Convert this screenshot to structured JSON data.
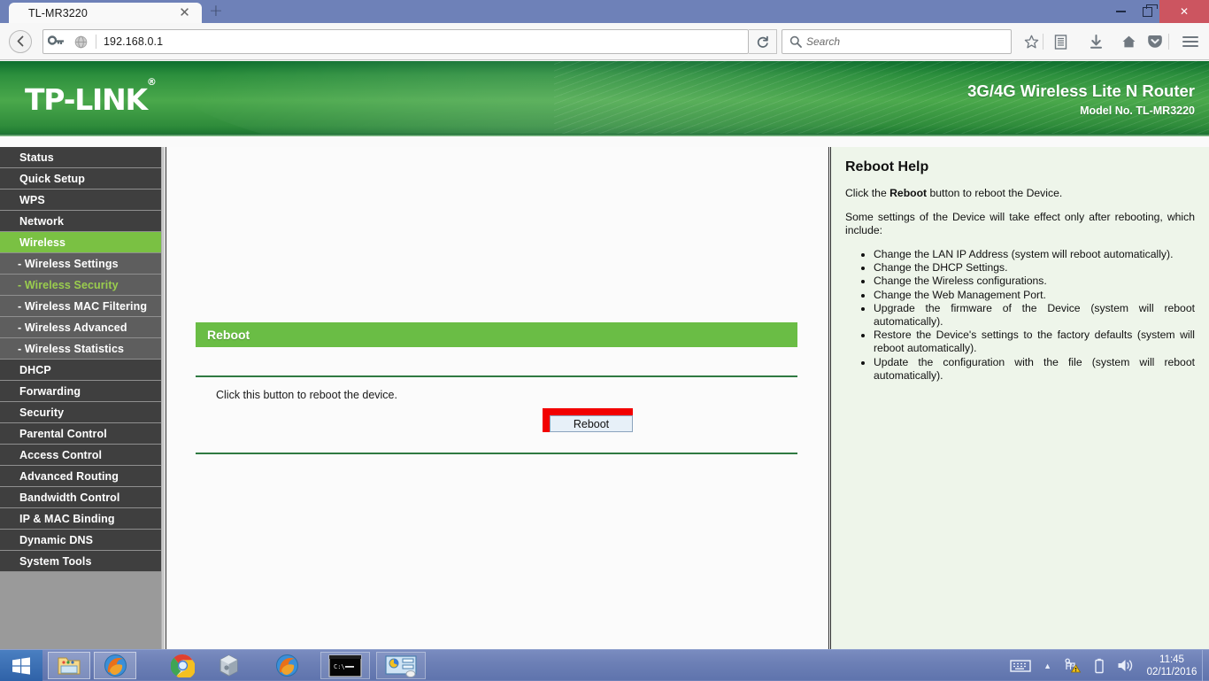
{
  "browser": {
    "tab_title": "TL-MR3220",
    "close_tab_glyph": "✕",
    "new_tab_glyph": "+",
    "back_glyph": "←",
    "reload_glyph": "⟳",
    "url": "192.168.0.1",
    "search_placeholder": "Search",
    "window_controls": {
      "minimize": "—",
      "maximize": "❐",
      "close": "✕"
    },
    "toolbar_icons": [
      "key-icon",
      "globe-icon",
      "star-icon",
      "library-icon",
      "downloads-icon",
      "home-icon",
      "pocket-icon",
      "menu-icon"
    ]
  },
  "router": {
    "brand": "TP-LINK",
    "brand_mark": "®",
    "model_title": "3G/4G Wireless Lite N Router",
    "model_no": "Model No. TL-MR3220",
    "accent_green": "#6abd45",
    "header_green": "#2c8f3d",
    "highlight_red": "#f20000"
  },
  "sidebar": {
    "items": [
      {
        "label": "Status",
        "type": "top",
        "state": "normal"
      },
      {
        "label": "Quick Setup",
        "type": "top",
        "state": "normal"
      },
      {
        "label": "WPS",
        "type": "top",
        "state": "normal"
      },
      {
        "label": "Network",
        "type": "top",
        "state": "normal"
      },
      {
        "label": "Wireless",
        "type": "top",
        "state": "active"
      },
      {
        "label": "- Wireless Settings",
        "type": "sub",
        "state": "normal"
      },
      {
        "label": "- Wireless Security",
        "type": "sub",
        "state": "sub-active"
      },
      {
        "label": "- Wireless MAC Filtering",
        "type": "sub",
        "state": "normal"
      },
      {
        "label": "- Wireless Advanced",
        "type": "sub",
        "state": "normal"
      },
      {
        "label": "- Wireless Statistics",
        "type": "sub",
        "state": "normal"
      },
      {
        "label": "DHCP",
        "type": "top",
        "state": "normal"
      },
      {
        "label": "Forwarding",
        "type": "top",
        "state": "normal"
      },
      {
        "label": "Security",
        "type": "top",
        "state": "normal"
      },
      {
        "label": "Parental Control",
        "type": "top",
        "state": "normal"
      },
      {
        "label": "Access Control",
        "type": "top",
        "state": "normal"
      },
      {
        "label": "Advanced Routing",
        "type": "top",
        "state": "normal"
      },
      {
        "label": "Bandwidth Control",
        "type": "top",
        "state": "normal"
      },
      {
        "label": "IP & MAC Binding",
        "type": "top",
        "state": "normal"
      },
      {
        "label": "Dynamic DNS",
        "type": "top",
        "state": "normal"
      },
      {
        "label": "System Tools",
        "type": "top",
        "state": "normal"
      }
    ]
  },
  "main": {
    "section_title": "Reboot",
    "description": "Click this button to reboot the device.",
    "reboot_button_label": "Reboot"
  },
  "help": {
    "title": "Reboot Help",
    "paragraph_1_pre": "Click the ",
    "paragraph_1_bold": "Reboot",
    "paragraph_1_post": " button to reboot the Device.",
    "paragraph_2": "Some settings of the Device will take effect only after rebooting, which include:",
    "bullets": [
      "Change the LAN IP Address (system will reboot automatically).",
      "Change the DHCP Settings.",
      "Change the Wireless configurations.",
      "Change the Web Management Port.",
      "Upgrade the firmware of the Device (system will reboot automatically).",
      "Restore the Device's settings to the factory defaults (system will reboot automatically).",
      "Update the configuration with the file (system will reboot automatically)."
    ]
  },
  "taskbar": {
    "start_label": "start-button",
    "apps": [
      {
        "name": "file-explorer-icon",
        "framed": true
      },
      {
        "name": "firefox-icon",
        "framed": true
      },
      {
        "name": "chrome-icon",
        "framed": false
      },
      {
        "name": "virtualbox-icon",
        "framed": false
      },
      {
        "name": "firefox-icon-2",
        "framed": false
      },
      {
        "name": "command-prompt-icon",
        "framed": true
      },
      {
        "name": "network-config-icon",
        "framed": true
      }
    ],
    "tray": {
      "keyboard_icon": "keyboard-icon",
      "expand_glyph": "▲",
      "network_icon": "network-warning-icon",
      "battery_icon": "battery-icon",
      "volume_icon": "volume-icon"
    },
    "clock_time": "11:45",
    "clock_date": "02/11/2016"
  }
}
